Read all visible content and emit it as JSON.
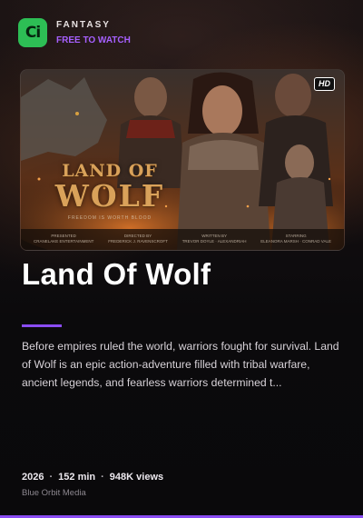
{
  "header": {
    "logo_text": "Ci",
    "genre": "FANTASY",
    "availability": "FREE TO WATCH"
  },
  "poster": {
    "badge": "HD",
    "title_line1": "LAND OF",
    "title_line2": "WOLF",
    "tagline": "FREEDOM IS WORTH BLOOD",
    "credits": [
      {
        "line1": "PRESENTED",
        "line2": "CRANELAKE ENTERTAINMENT"
      },
      {
        "line1": "DIRECTED BY",
        "line2": "FREDERICK J. RAVENSCROFT"
      },
      {
        "line1": "WRITTEN BY",
        "line2": "TREVOR DOYLE · ALEXANDRIAH"
      },
      {
        "line1": "STARRING",
        "line2": "ELEANORA MARSH · CONRAD VALE"
      }
    ]
  },
  "movie": {
    "title": "Land Of Wolf",
    "description": "Before empires ruled the world, warriors fought for survival. Land of Wolf is an epic action-adventure filled with tribal warfare, ancient legends, and fearless warriors determined t...",
    "year": "2026",
    "runtime": "152 min",
    "views": "948K views",
    "studio": "Blue Orbit Media",
    "separator": "·"
  },
  "colors": {
    "accent": "#8a4cf3",
    "logo_bg": "#2dbe55",
    "free_label": "#a660ff"
  }
}
